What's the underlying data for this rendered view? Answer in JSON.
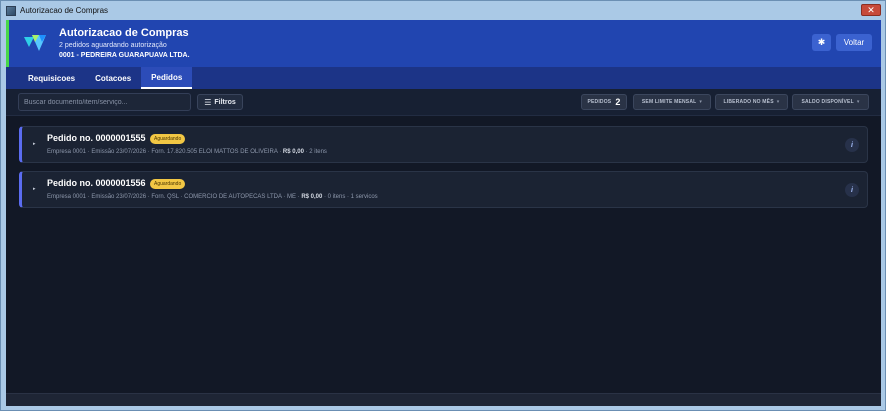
{
  "window": {
    "title": "Autorizacao de Compras",
    "close_label": "✕"
  },
  "header": {
    "title": "Autorizacao de Compras",
    "subtitle": "2 pedidos aguardando autorização",
    "company": "0001 - PEDREIRA GUARAPUAVA LTDA.",
    "theme_icon": "✱",
    "back_label": "Voltar",
    "accent_color": "#47d84a",
    "brand_color": "#2145b0"
  },
  "tabs": [
    {
      "label": "Requisicoes"
    },
    {
      "label": "Cotacoes"
    },
    {
      "label": "Pedidos",
      "active": true
    }
  ],
  "toolbar": {
    "search_placeholder": "Buscar documento/item/serviço...",
    "filters_label": "Filtros",
    "filters_icon": "☰",
    "chips": {
      "pedidos_label": "PEDIDOS",
      "pedidos_count": "2",
      "limite_label": "SEM LIMITE MENSAL",
      "liberado_label": "LIBERADO NO MÊS",
      "saldo_label": "SALDO DISPONÍVEL",
      "caret": "▾"
    }
  },
  "orders": [
    {
      "title": "Pedido no. 0000001555",
      "status": "Aguardando",
      "meta_prefix": "Empresa 0001 · Emissão 23/07/2026 · Forn. 17.820.505 ELOI MATTOS DE OLIVEIRA · ",
      "amount": "R$ 0,00",
      "meta_suffix": " · 2 itens",
      "chevron": "▸",
      "info": "i"
    },
    {
      "title": "Pedido no. 0000001556",
      "status": "Aguardando",
      "meta_prefix": "Empresa 0001 · Emissão 23/07/2026 · Forn. QSL · COMERCIO DE AUTOPECAS LTDA · ME · ",
      "amount": "R$ 0,00",
      "meta_suffix": " · 0 itens · 1 servicos",
      "chevron": "▸",
      "info": "i"
    }
  ],
  "colors": {
    "background": "#121826",
    "card_border_accent": "#5b6cf0",
    "status_badge": "#f2c744"
  }
}
